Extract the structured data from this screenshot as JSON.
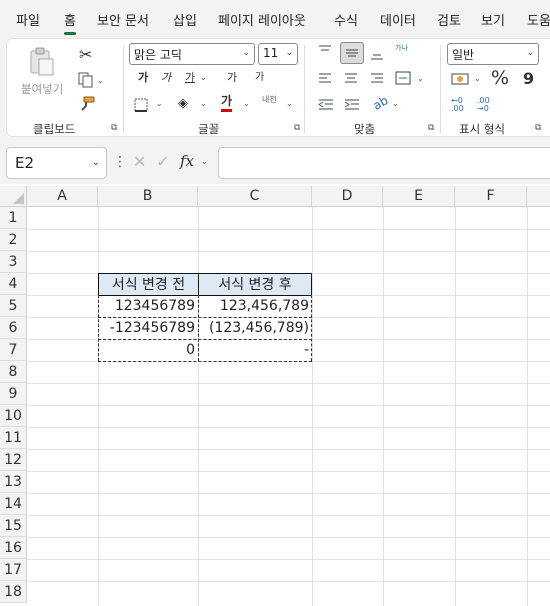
{
  "tabs": [
    {
      "label": "파일"
    },
    {
      "label": "홈"
    },
    {
      "label": "보안 문서"
    },
    {
      "label": "삽입"
    },
    {
      "label": "페이지 레이아웃"
    },
    {
      "label": "수식"
    },
    {
      "label": "데이터"
    },
    {
      "label": "검토"
    },
    {
      "label": "보기"
    },
    {
      "label": "도움"
    }
  ],
  "ribbon": {
    "clipboard": {
      "paste_label": "붙여넣기",
      "group_label": "클립보드"
    },
    "font": {
      "font_name": "맑은 고딕",
      "font_size": "11",
      "bold": "가",
      "italic": "가",
      "underline": "가",
      "grow": "가",
      "shrink": "가",
      "font_color_glyph": "가",
      "phonetic": "내천",
      "group_label": "글꼴",
      "font_color": "#e00000"
    },
    "alignment": {
      "wrap_glyph": "가나",
      "group_label": "맞춤"
    },
    "number": {
      "format": "일반",
      "percent": "%",
      "comma": "9",
      "inc_decimal": "←0 .00",
      "dec_decimal": ".00 →0",
      "group_label": "표시 형식"
    }
  },
  "formula_bar": {
    "name_box": "E2",
    "fx": "fx",
    "formula": ""
  },
  "sheet": {
    "columns": [
      "A",
      "B",
      "C",
      "D",
      "E",
      "F"
    ],
    "rows": [
      "1",
      "2",
      "3",
      "4",
      "5",
      "6",
      "7",
      "8",
      "9",
      "10",
      "11",
      "12",
      "13",
      "14",
      "15",
      "16",
      "17",
      "18"
    ],
    "header_fill": "#dde9f5",
    "table": {
      "header_b": "서식 변경 전",
      "header_c": "서식 변경 후",
      "r5": {
        "b": "123456789",
        "c": "123,456,789"
      },
      "r6": {
        "b": "-123456789",
        "c": "(123,456,789)"
      },
      "r7": {
        "b": "0",
        "c": "-"
      }
    }
  }
}
